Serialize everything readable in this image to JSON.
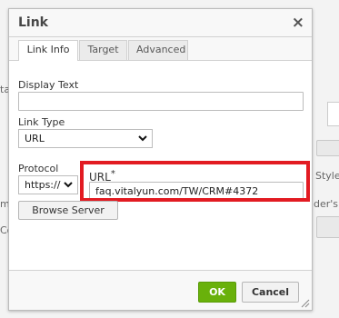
{
  "dialog": {
    "title": "Link",
    "close_glyph": "×",
    "tabs": [
      {
        "label": "Link Info",
        "active": true
      },
      {
        "label": "Target",
        "active": false
      },
      {
        "label": "Advanced",
        "active": false
      }
    ]
  },
  "form": {
    "display_text_label": "Display Text",
    "display_text_value": "",
    "link_type_label": "Link Type",
    "link_type_value": "URL",
    "protocol_label": "Protocol",
    "protocol_value": "https://",
    "url_label": "URL",
    "url_required_marker": "*",
    "url_value": "faq.vitalyun.com/TW/CRM#4372",
    "browse_label": "Browse Server"
  },
  "footer": {
    "ok_label": "OK",
    "cancel_label": "Cancel"
  },
  "background_fragments": {
    "left_1": "ta",
    "right_1": "Style",
    "right_2": "der's",
    "left_2": "Co",
    "left_3": "me"
  },
  "colors": {
    "ok_green": "#69b10b",
    "highlight_red": "#e21b22"
  },
  "icons": {
    "close": "close-icon",
    "dropdown": "chevron-down-icon",
    "resize": "resize-handle-icon"
  }
}
